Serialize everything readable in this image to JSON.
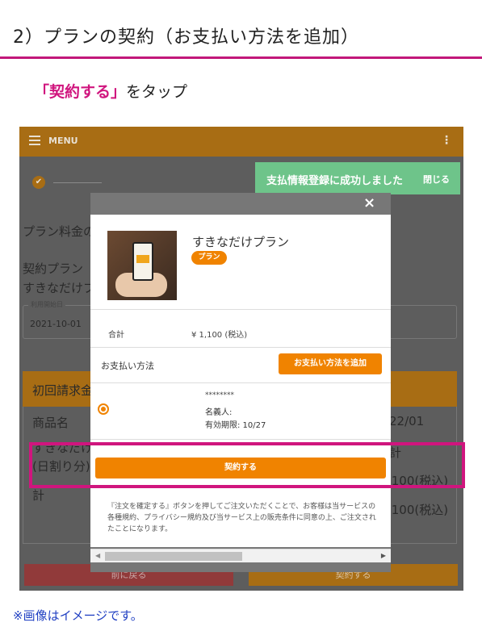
{
  "step_title": "2）プランの契約（お支払い方法を追加）",
  "instruction": {
    "emphasis": "「契約する」",
    "rest": "をタップ"
  },
  "app": {
    "menu_label": "MENU",
    "kebab_glyph": "⋮",
    "stepper_check_glyph": "✔",
    "toast": {
      "message": "支払情報登録に成功しました",
      "close_label": "閉じる"
    },
    "background": {
      "plan_fee_label": "プラン料金の",
      "contract_plan_label": "契約プラン",
      "plan_name_partial": "すきなだけプ",
      "start_date_label": "利用開始日",
      "start_date_value": "2021-10-01",
      "first_invoice_label": "初回請求金",
      "product_name_header": "商品名",
      "date_partial": "22/01",
      "item_name_partial": "すきなだけ",
      "prorated_label": "(日割り分)",
      "col_partial": "計",
      "price_tax_1": ",100(税込)",
      "total_label_partial": "計",
      "price_tax_2": ",100(税込)",
      "back_button": "前に戻る",
      "contract_button": "契約する"
    },
    "modal": {
      "close_glyph": "×",
      "plan_name": "すきなだけプラン",
      "plan_badge": "プラン",
      "total_label": "合計",
      "total_value": "¥ 1,100 (税込)",
      "payment_method_label": "お支払い方法",
      "add_payment_button": "お支払い方法を追加",
      "card_mask": "********",
      "card_holder_label": "名義人:",
      "card_expiry": "有効期限: 10/27",
      "submit_button": "契約する",
      "terms_text": "『注文を確定する』ボタンを押してご注文いただくことで、お客様は当サービスの各種規約、プライバシー規約及び当サービス上の販売条件に同意の上、ご注文されたことになります。",
      "scroll_left_glyph": "◀",
      "scroll_right_glyph": "▶"
    }
  },
  "footnote": "※画像はイメージです。",
  "colors": {
    "accent": "#f08300",
    "highlight": "#d0157e",
    "toast": "#6ec48a",
    "footnote": "#1f3fc2"
  }
}
